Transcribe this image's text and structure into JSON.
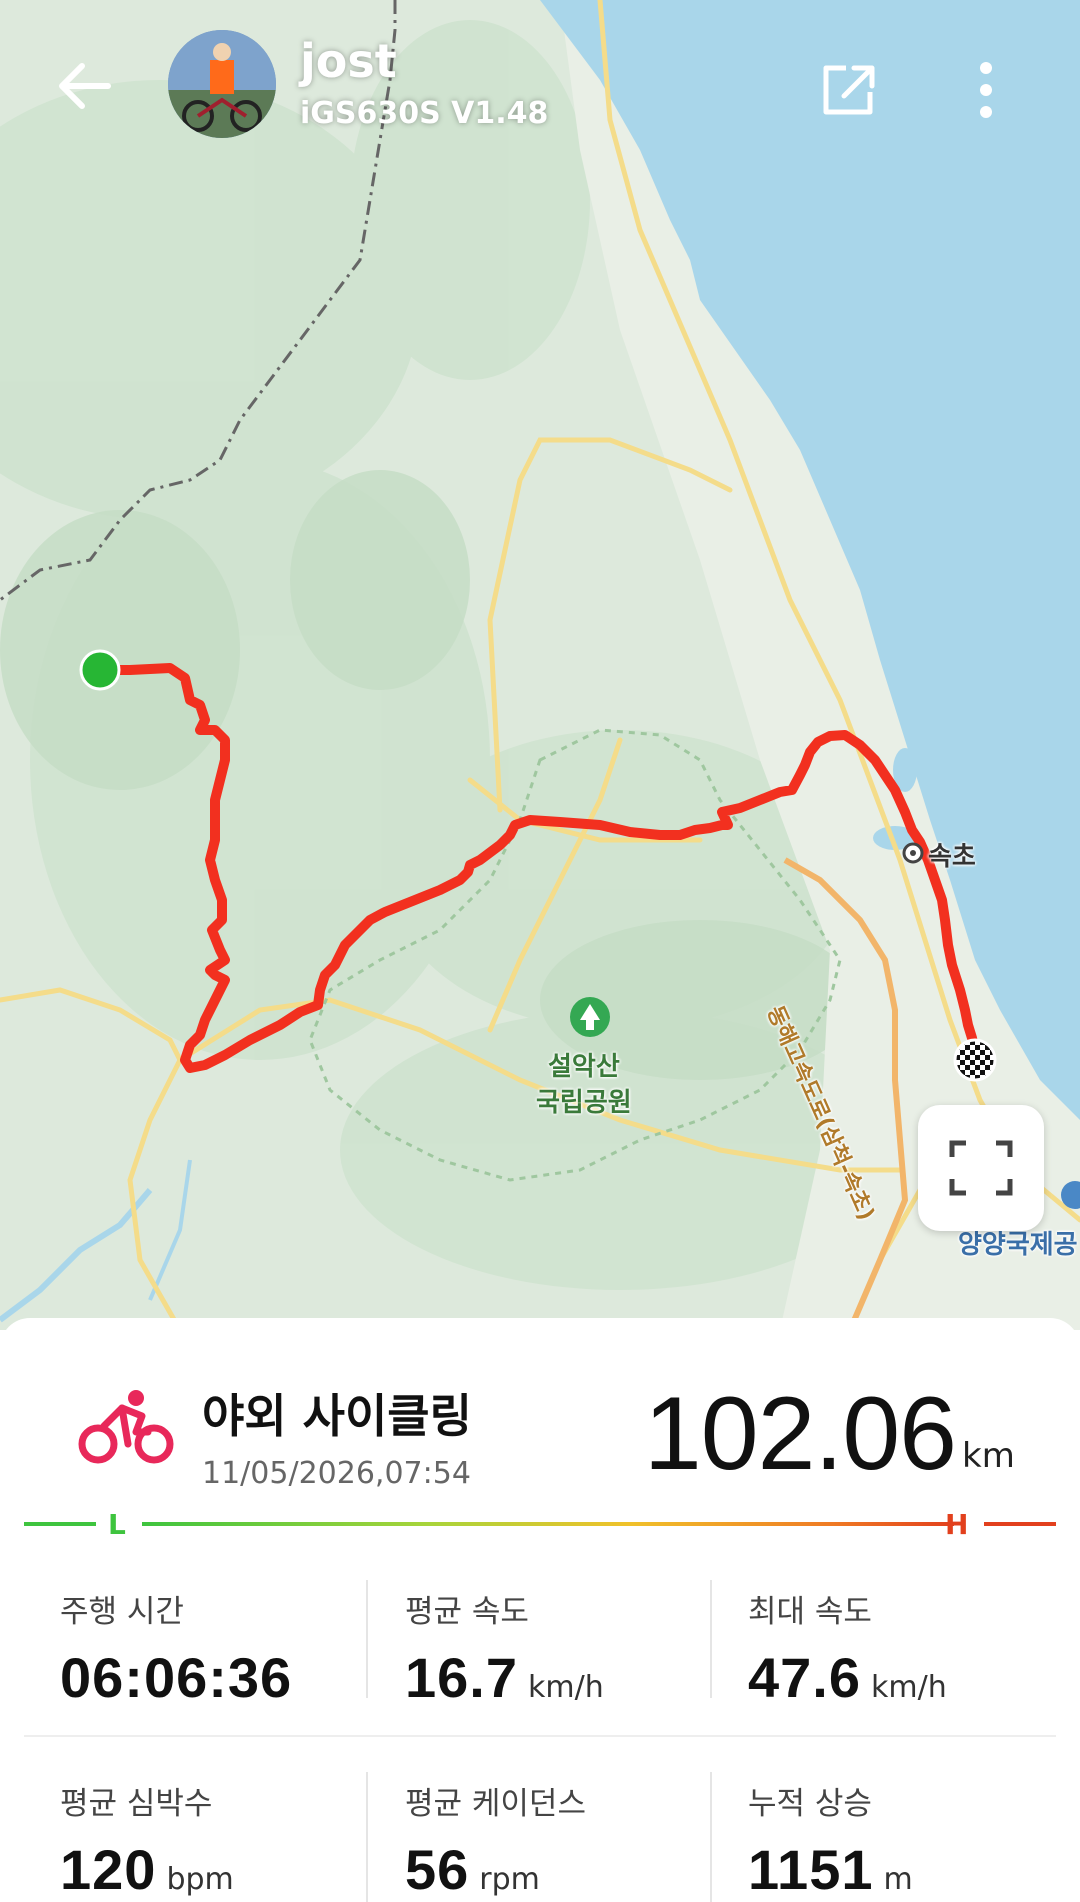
{
  "header": {
    "user_name": "jost",
    "device_name": "iGS630S  V1.48",
    "back_icon": "arrow-left-icon",
    "share_icon": "share-external-icon",
    "more_icon": "more-vertical-icon"
  },
  "map": {
    "labels": {
      "city": "속초",
      "park_line1": "설악산",
      "park_line2": "국립공원",
      "highway": "동해고속도로(삼척-속초)",
      "airport_partial": "양양국제공"
    },
    "route_color": "#f2301f",
    "start_marker_color": "#27b634",
    "fullscreen_icon": "fullscreen-icon"
  },
  "activity": {
    "icon": "cycling-icon",
    "icon_color": "#e8285a",
    "name": "야외 사이클링",
    "datetime": "11/05/2026,07:54",
    "distance": "102.06",
    "distance_unit": "km"
  },
  "intensity": {
    "low_label": "L",
    "high_label": "H",
    "low_color": "#3ec43e",
    "high_color": "#e2401d"
  },
  "stats": [
    {
      "label": "주행 시간",
      "value": "06:06:36",
      "unit": ""
    },
    {
      "label": "평균 속도",
      "value": "16.7",
      "unit": "km/h"
    },
    {
      "label": "최대 속도",
      "value": "47.6",
      "unit": "km/h"
    },
    {
      "label": "평균 심박수",
      "value": "120",
      "unit": "bpm"
    },
    {
      "label": "평균 케이던스",
      "value": "56",
      "unit": "rpm"
    },
    {
      "label": "누적 상승",
      "value": "1151",
      "unit": "m"
    }
  ]
}
